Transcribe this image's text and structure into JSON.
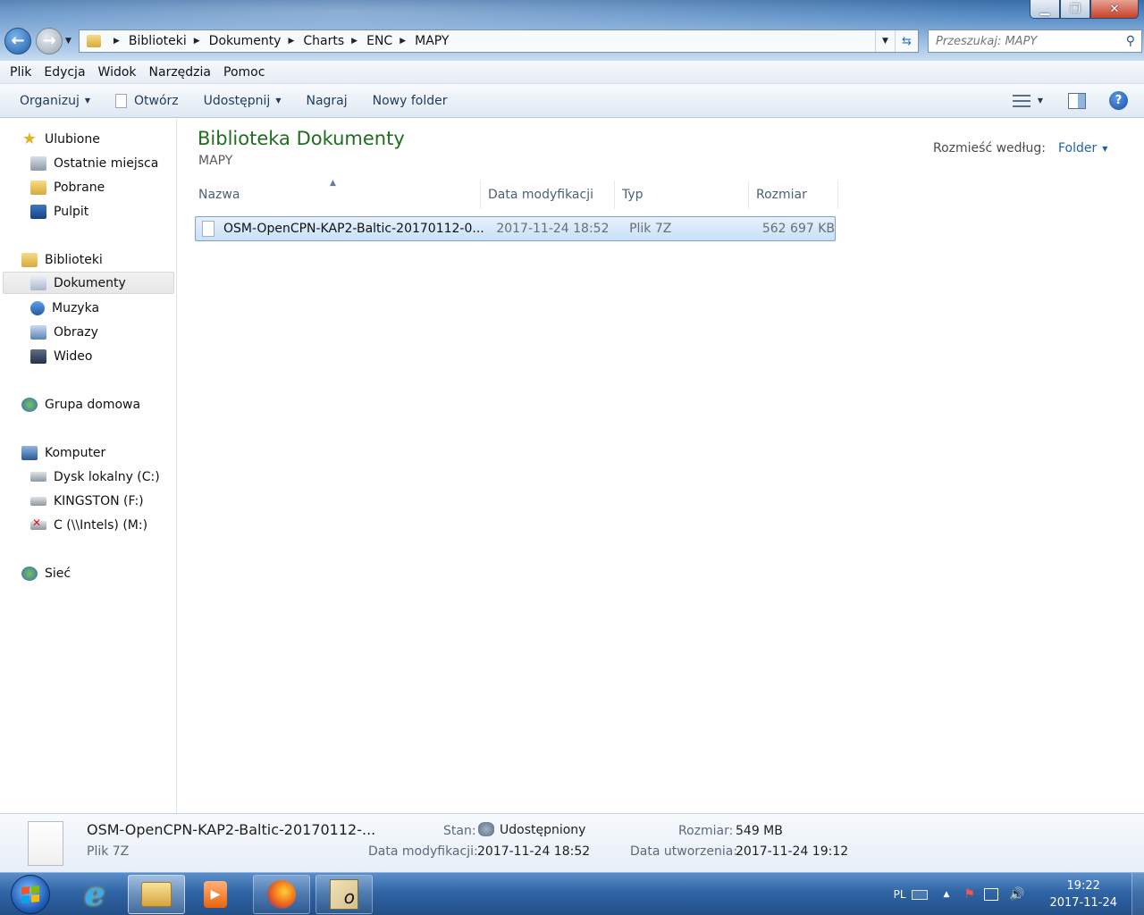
{
  "address": {
    "breadcrumbs": [
      "Biblioteki",
      "Dokumenty",
      "Charts",
      "ENC",
      "MAPY"
    ]
  },
  "search": {
    "placeholder": "Przeszukaj: MAPY"
  },
  "menu": [
    "Plik",
    "Edycja",
    "Widok",
    "Narzędzia",
    "Pomoc"
  ],
  "toolbar": {
    "organize": "Organizuj",
    "open": "Otwórz",
    "share": "Udostępnij",
    "burn": "Nagraj",
    "new_folder": "Nowy folder"
  },
  "nav": {
    "favorites": "Ulubione",
    "recent": "Ostatnie miejsca",
    "downloads": "Pobrane",
    "desktop": "Pulpit",
    "libraries": "Biblioteki",
    "documents": "Dokumenty",
    "music": "Muzyka",
    "pictures": "Obrazy",
    "video": "Wideo",
    "homegroup": "Grupa domowa",
    "computer": "Komputer",
    "drive_c": "Dysk lokalny (C:)",
    "drive_f": "KINGSTON (F:)",
    "drive_m": "C (\\\\Intels) (M:)",
    "network": "Sieć"
  },
  "content": {
    "title": "Biblioteka Dokumenty",
    "subtitle": "MAPY",
    "arrange_label": "Rozmieść według:",
    "arrange_value": "Folder",
    "columns": {
      "name": "Nazwa",
      "date": "Data modyfikacji",
      "type": "Typ",
      "size": "Rozmiar"
    },
    "files": [
      {
        "name": "OSM-OpenCPN-KAP2-Baltic-20170112-0...",
        "date": "2017-11-24 18:52",
        "type": "Plik 7Z",
        "size": "562 697 KB"
      }
    ]
  },
  "details": {
    "name": "OSM-OpenCPN-KAP2-Baltic-20170112-...",
    "type": "Plik 7Z",
    "status_label": "Stan:",
    "status_value": "Udostępniony",
    "modified_label": "Data modyfikacji:",
    "modified_value": "2017-11-24 18:52",
    "size_label": "Rozmiar:",
    "size_value": "549 MB",
    "created_label": "Data utworzenia:",
    "created_value": "2017-11-24 19:12"
  },
  "tray": {
    "lang": "PL",
    "time": "19:22",
    "date": "2017-11-24"
  },
  "colors": {
    "library_title": "#1e6e1e",
    "accent_link": "#1f5fb0",
    "selection": "#c8e0f8"
  }
}
